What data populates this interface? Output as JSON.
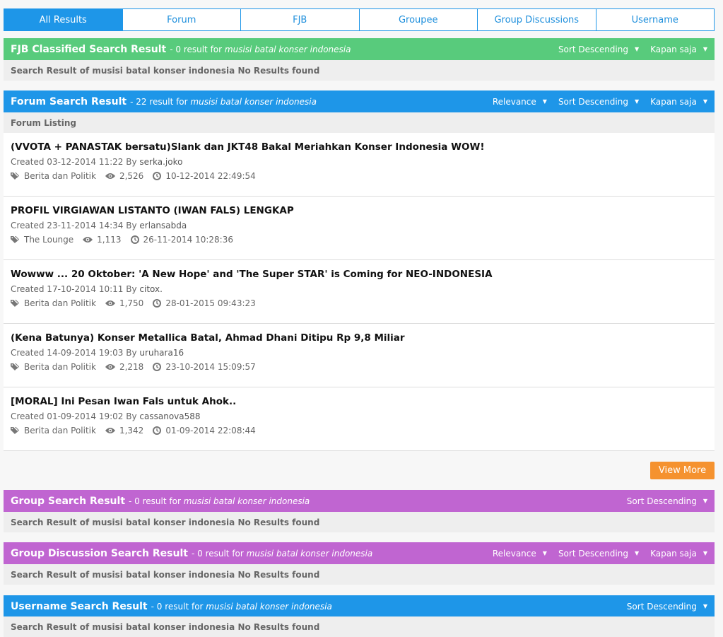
{
  "tabs": [
    {
      "label": "All Results",
      "active": true
    },
    {
      "label": "Forum"
    },
    {
      "label": "FJB"
    },
    {
      "label": "Groupee"
    },
    {
      "label": "Group Discussions"
    },
    {
      "label": "Username"
    }
  ],
  "fjb": {
    "title": "FJB Classified Search Result",
    "count_prefix": "- 0 result for",
    "query": "musisi batal konser indonesia",
    "sort": "Sort Descending",
    "time": "Kapan saja",
    "no_results": "Search Result of musisi batal konser indonesia No Results found"
  },
  "forum": {
    "title": "Forum Search Result",
    "count_prefix": "- 22 result for",
    "query": "musisi batal konser indonesia",
    "relevance": "Relevance",
    "sort": "Sort Descending",
    "time": "Kapan saja",
    "listing_label": "Forum Listing",
    "items": [
      {
        "title": "(VVOTA + PANASTAK bersatu)Slank dan JKT48 Bakal Meriahkan Konser Indonesia WOW!",
        "created": "Created 03-12-2014 11:22 By",
        "author": "serka.joko",
        "category": "Berita dan Politik",
        "views": "2,526",
        "last": "10-12-2014 22:49:54"
      },
      {
        "title": "PROFIL VIRGIAWAN LISTANTO (IWAN FALS) LENGKAP",
        "created": "Created 23-11-2014 14:34 By",
        "author": "erlansabda",
        "category": "The Lounge",
        "views": "1,113",
        "last": "26-11-2014 10:28:36"
      },
      {
        "title": "Wowww ... 20 Oktober: 'A New Hope' and 'The Super STAR' is Coming for NEO-INDONESIA",
        "created": "Created 17-10-2014 10:11 By",
        "author": "citox.",
        "category": "Berita dan Politik",
        "views": "1,750",
        "last": "28-01-2015 09:43:23"
      },
      {
        "title": "(Kena Batunya) Konser Metallica Batal, Ahmad Dhani Ditipu Rp 9,8 Miliar",
        "created": "Created 14-09-2014 19:03 By",
        "author": "uruhara16",
        "category": "Berita dan Politik",
        "views": "2,218",
        "last": "23-10-2014 15:09:57"
      },
      {
        "title": "[MORAL] Ini Pesan Iwan Fals untuk Ahok..",
        "created": "Created 01-09-2014 19:02 By",
        "author": "cassanova588",
        "category": "Berita dan Politik",
        "views": "1,342",
        "last": "01-09-2014 22:08:44"
      }
    ],
    "view_more": "View More"
  },
  "group": {
    "title": "Group Search Result",
    "count_prefix": "- 0 result for",
    "query": "musisi batal konser indonesia",
    "sort": "Sort Descending",
    "no_results": "Search Result of musisi batal konser indonesia No Results found"
  },
  "group_discussion": {
    "title": "Group Discussion Search Result",
    "count_prefix": "- 0 result for",
    "query": "musisi batal konser indonesia",
    "relevance": "Relevance",
    "sort": "Sort Descending",
    "time": "Kapan saja",
    "no_results": "Search Result of musisi batal konser indonesia No Results found"
  },
  "username": {
    "title": "Username Search Result",
    "count_prefix": "- 0 result for",
    "query": "musisi batal konser indonesia",
    "sort": "Sort Descending",
    "no_results": "Search Result of musisi batal konser indonesia No Results found"
  },
  "icons": {
    "caret": "caret-down-icon",
    "category": "tags-icon",
    "views": "eye-icon",
    "last_post": "clock-icon"
  },
  "colors": {
    "tab_blue": "#1e96e8",
    "fjb_green": "#58cb7c",
    "forum_blue": "#1e96e8",
    "group_purple": "#c065d1",
    "view_more_orange": "#f5922f"
  }
}
